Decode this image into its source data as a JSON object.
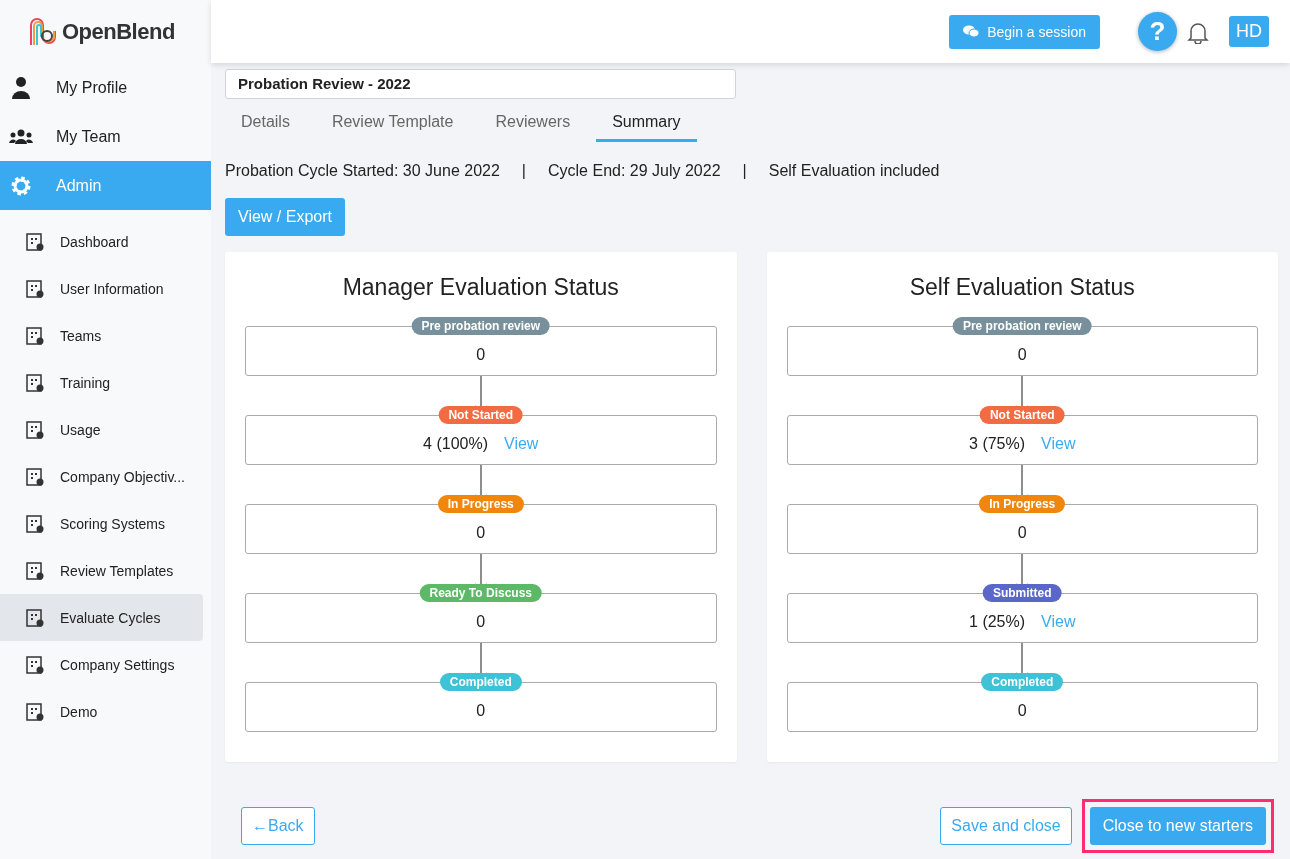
{
  "brand": {
    "name": "OpenBlend"
  },
  "sidebar": {
    "items": [
      {
        "label": "My Profile",
        "selected": false
      },
      {
        "label": "My Team",
        "selected": false
      },
      {
        "label": "Admin",
        "selected": true
      }
    ],
    "sub_items": [
      {
        "label": "Dashboard",
        "selected": false
      },
      {
        "label": "User Information",
        "selected": false
      },
      {
        "label": "Teams",
        "selected": false
      },
      {
        "label": "Training",
        "selected": false
      },
      {
        "label": "Usage",
        "selected": false
      },
      {
        "label": "Company Objectiv...",
        "selected": false
      },
      {
        "label": "Scoring Systems",
        "selected": false
      },
      {
        "label": "Review Templates",
        "selected": false
      },
      {
        "label": "Evaluate Cycles",
        "selected": true
      },
      {
        "label": "Company Settings",
        "selected": false
      },
      {
        "label": "Demo",
        "selected": false
      }
    ]
  },
  "header": {
    "session_button": "Begin a session",
    "help": "?",
    "avatar": "HD"
  },
  "cycle_name": "Probation Review - 2022",
  "tabs": [
    {
      "label": "Details",
      "selected": false
    },
    {
      "label": "Review Template",
      "selected": false
    },
    {
      "label": "Reviewers",
      "selected": false
    },
    {
      "label": "Summary",
      "selected": true
    }
  ],
  "info": {
    "started": "Probation Cycle Started: 30 June 2022",
    "separator": "|",
    "end": "Cycle End: 29 July 2022",
    "self": "Self Evaluation included"
  },
  "export_button": "View / Export",
  "panels": [
    {
      "title": "Manager Evaluation Status",
      "stages": [
        {
          "label": "Pre probation review",
          "color": "#78909c",
          "value": "0"
        },
        {
          "label": "Not Started",
          "color": "#f26b43",
          "value": "4 (100%)",
          "link": "View"
        },
        {
          "label": "In Progress",
          "color": "#f0870c",
          "value": "0"
        },
        {
          "label": "Ready To Discuss",
          "color": "#5db867",
          "value": "0"
        },
        {
          "label": "Completed",
          "color": "#3ec2d6",
          "value": "0"
        }
      ]
    },
    {
      "title": "Self Evaluation Status",
      "stages": [
        {
          "label": "Pre probation review",
          "color": "#78909c",
          "value": "0"
        },
        {
          "label": "Not Started",
          "color": "#f26b43",
          "value": "3 (75%)",
          "link": "View"
        },
        {
          "label": "In Progress",
          "color": "#f0870c",
          "value": "0"
        },
        {
          "label": "Submitted",
          "color": "#5a67c8",
          "value": "1 (25%)",
          "link": "View"
        },
        {
          "label": "Completed",
          "color": "#3ec2d6",
          "value": "0"
        }
      ]
    }
  ],
  "footer": {
    "back": "Back",
    "back_arrow": "←",
    "save": "Save and close",
    "close": {
      "label": "Close to new starters",
      "highlighted": true
    }
  }
}
